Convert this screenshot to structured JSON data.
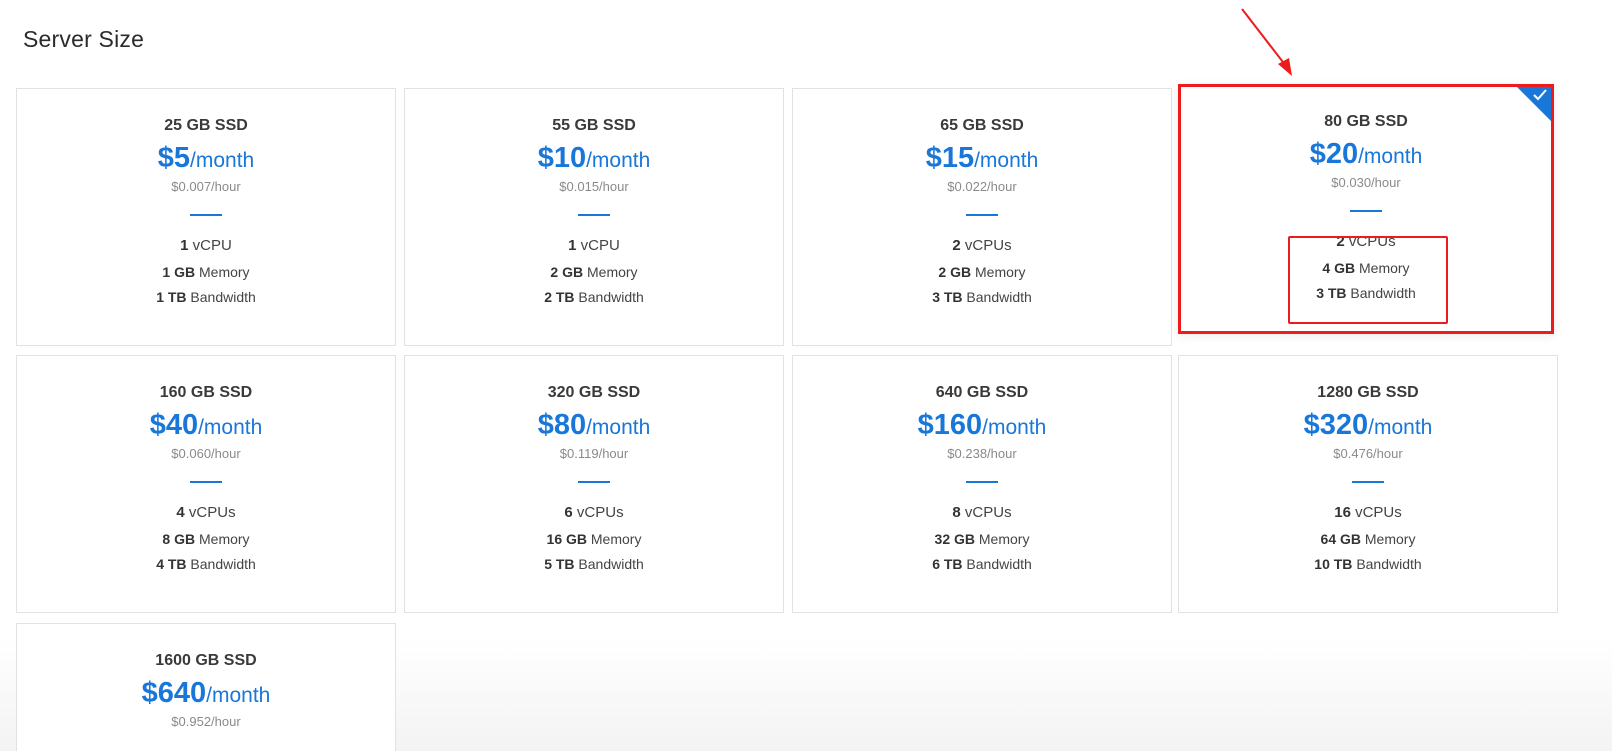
{
  "page": {
    "title": "Server Size"
  },
  "colors": {
    "accent": "#1877d9",
    "highlight": "#ec1c1c"
  },
  "plans": [
    {
      "disk": "25 GB SSD",
      "price": "$5",
      "per": "/month",
      "hourly": "$0.007/hour",
      "cpu_val": "1",
      "cpu_unit": "vCPU",
      "mem_val": "1 GB",
      "mem_unit": "Memory",
      "bw_val": "1 TB",
      "bw_unit": "Bandwidth"
    },
    {
      "disk": "55 GB SSD",
      "price": "$10",
      "per": "/month",
      "hourly": "$0.015/hour",
      "cpu_val": "1",
      "cpu_unit": "vCPU",
      "mem_val": "2 GB",
      "mem_unit": "Memory",
      "bw_val": "2 TB",
      "bw_unit": "Bandwidth"
    },
    {
      "disk": "65 GB SSD",
      "price": "$15",
      "per": "/month",
      "hourly": "$0.022/hour",
      "cpu_val": "2",
      "cpu_unit": "vCPUs",
      "mem_val": "2 GB",
      "mem_unit": "Memory",
      "bw_val": "3 TB",
      "bw_unit": "Bandwidth"
    },
    {
      "disk": "80 GB SSD",
      "price": "$20",
      "per": "/month",
      "hourly": "$0.030/hour",
      "cpu_val": "2",
      "cpu_unit": "vCPUs",
      "mem_val": "4 GB",
      "mem_unit": "Memory",
      "bw_val": "3 TB",
      "bw_unit": "Bandwidth",
      "selected": true
    },
    {
      "disk": "160 GB SSD",
      "price": "$40",
      "per": "/month",
      "hourly": "$0.060/hour",
      "cpu_val": "4",
      "cpu_unit": "vCPUs",
      "mem_val": "8 GB",
      "mem_unit": "Memory",
      "bw_val": "4 TB",
      "bw_unit": "Bandwidth"
    },
    {
      "disk": "320 GB SSD",
      "price": "$80",
      "per": "/month",
      "hourly": "$0.119/hour",
      "cpu_val": "6",
      "cpu_unit": "vCPUs",
      "mem_val": "16 GB",
      "mem_unit": "Memory",
      "bw_val": "5 TB",
      "bw_unit": "Bandwidth"
    },
    {
      "disk": "640 GB SSD",
      "price": "$160",
      "per": "/month",
      "hourly": "$0.238/hour",
      "cpu_val": "8",
      "cpu_unit": "vCPUs",
      "mem_val": "32 GB",
      "mem_unit": "Memory",
      "bw_val": "6 TB",
      "bw_unit": "Bandwidth"
    },
    {
      "disk": "1280 GB SSD",
      "price": "$320",
      "per": "/month",
      "hourly": "$0.476/hour",
      "cpu_val": "16",
      "cpu_unit": "vCPUs",
      "mem_val": "64 GB",
      "mem_unit": "Memory",
      "bw_val": "10 TB",
      "bw_unit": "Bandwidth"
    },
    {
      "disk": "1600 GB SSD",
      "price": "$640",
      "per": "/month",
      "hourly": "$0.952/hour"
    }
  ]
}
